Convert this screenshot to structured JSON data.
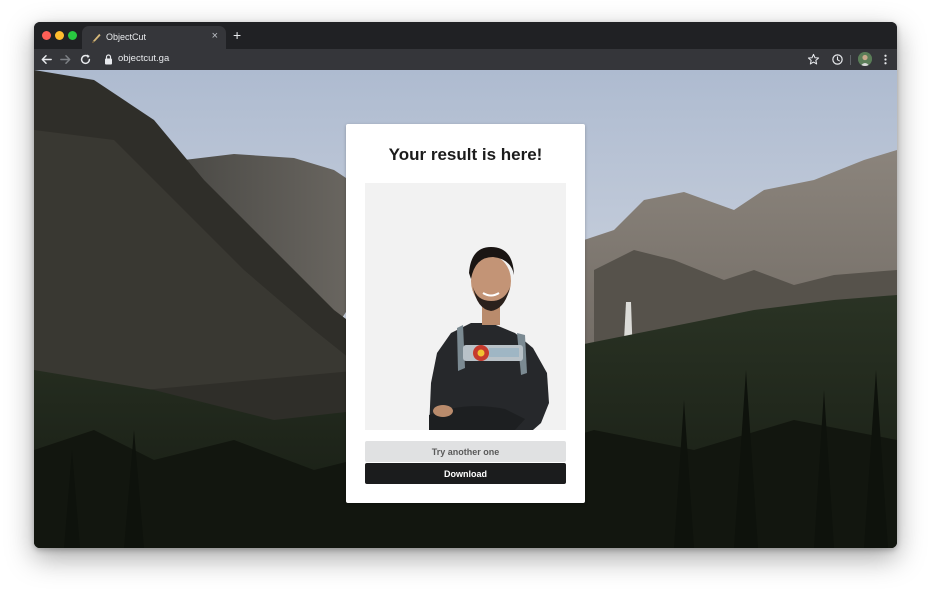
{
  "browser": {
    "tab_title": "ObjectCut",
    "tab_close_glyph": "×",
    "new_tab_glyph": "+",
    "url": "objectcut.ga"
  },
  "result": {
    "title": "Your result is here!",
    "try_label": "Try another one",
    "download_label": "Download"
  },
  "colors": {
    "browser_chrome": "#202124",
    "toolbar": "#35363a",
    "card": "#ffffff",
    "image_bg": "#f2f2f2",
    "try_button": "#e0e1e2",
    "download_button": "#1b1c1d"
  },
  "icons": [
    "knife-favicon-icon",
    "back-arrow-icon",
    "forward-arrow-icon",
    "reload-icon",
    "lock-icon",
    "star-icon",
    "extension-icon",
    "avatar",
    "menu-icon"
  ]
}
